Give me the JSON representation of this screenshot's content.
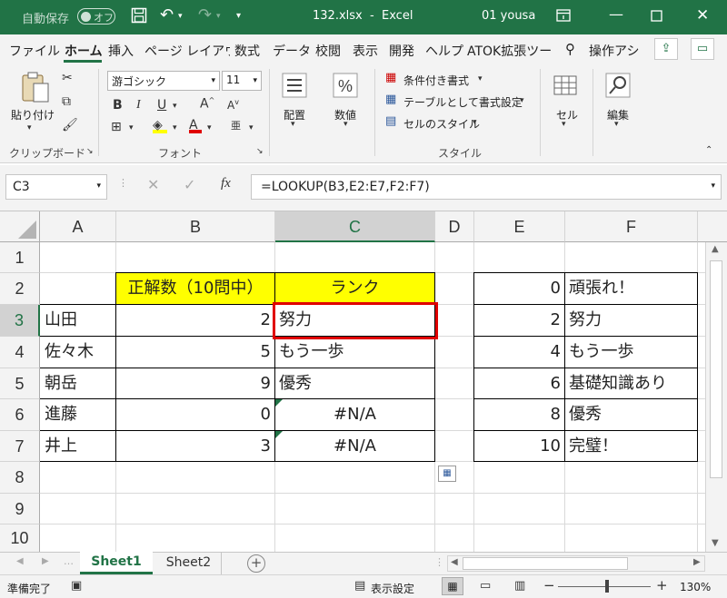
{
  "titlebar": {
    "autosave_label": "自動保存",
    "autosave_state": "オフ",
    "filename": "132.xlsx",
    "separator": "-",
    "app": "Excel",
    "user": "01 yousa"
  },
  "ribbon_tabs": [
    "ファイル",
    "ホーム",
    "挿入",
    "ページ レイアウト",
    "数式",
    "データ",
    "校閲",
    "表示",
    "開発",
    "ヘルプ",
    "ATOK拡張ツー"
  ],
  "search_tab": "操作アシ",
  "ribbon": {
    "clipboard": {
      "paste": "貼り付け",
      "label": "クリップボード"
    },
    "font": {
      "name": "游ゴシック",
      "size": "11",
      "label": "フォント"
    },
    "alignment": {
      "label": "配置"
    },
    "number": {
      "label": "数値"
    },
    "styles": {
      "conditional": "条件付き書式",
      "table": "テーブルとして書式設定",
      "cell_styles": "セルのスタイル",
      "label": "スタイル"
    },
    "cells": {
      "label": "セル"
    },
    "editing": {
      "label": "編集"
    }
  },
  "formula_bar": {
    "name_box": "C3",
    "formula": "=LOOKUP(B3,E2:E7,F2:F7)"
  },
  "columns": [
    "A",
    "B",
    "C",
    "D",
    "E",
    "F"
  ],
  "rows": [
    "1",
    "2",
    "3",
    "4",
    "5",
    "6",
    "7",
    "8",
    "9",
    "10"
  ],
  "cells": {
    "B2": "正解数（10問中）",
    "C2": "ランク",
    "A3": "山田",
    "B3": "2",
    "C3": "努力",
    "A4": "佐々木",
    "B4": "5",
    "C4": "もう一歩",
    "A5": "朝岳",
    "B5": "9",
    "C5": "優秀",
    "A6": "進藤",
    "B6": "0",
    "C6": "#N/A",
    "A7": "井上",
    "B7": "3",
    "C7": "#N/A",
    "E2": "0",
    "F2": "頑張れ！",
    "E3": "2",
    "F3": "努力",
    "E4": "4",
    "F4": "もう一歩",
    "E5": "6",
    "F5": "基礎知識あり",
    "E6": "8",
    "F6": "優秀",
    "E7": "10",
    "F7": "完璧！"
  },
  "colors": {
    "excel_green": "#217346",
    "header_fill": "#ffff00",
    "selection_border": "#e00000"
  },
  "sheets": [
    "Sheet1",
    "Sheet2"
  ],
  "active_sheet": "Sheet1",
  "status": {
    "ready": "準備完了",
    "display_settings": "表示設定",
    "zoom": "130%"
  }
}
